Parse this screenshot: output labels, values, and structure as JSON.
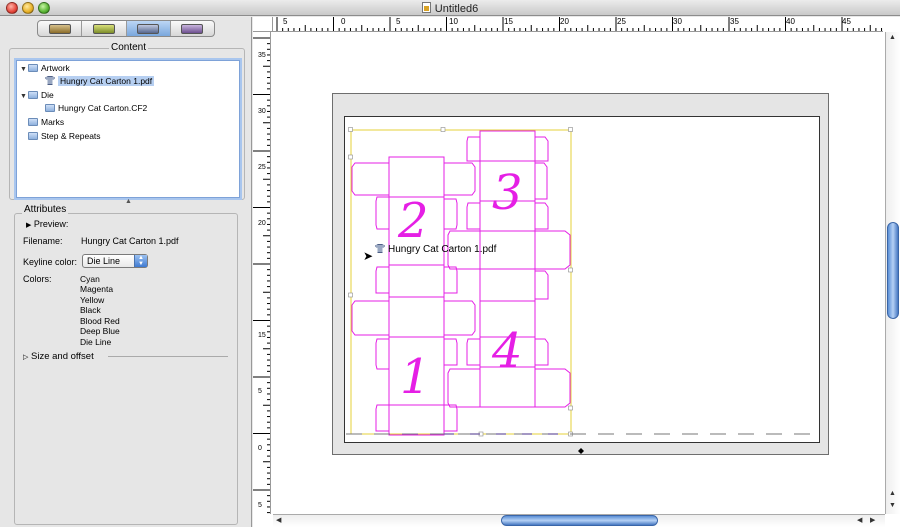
{
  "window": {
    "title": "Untitled6"
  },
  "toolbar": {
    "tabs": [
      "job",
      "marks",
      "artwork",
      "sheet"
    ]
  },
  "content": {
    "title": "Content",
    "tree": [
      {
        "label": "Artwork",
        "level": 0,
        "expanded": true,
        "kind": "folder"
      },
      {
        "label": "Hungry Cat Carton 1.pdf",
        "level": 1,
        "kind": "file",
        "selected": true
      },
      {
        "label": "Die",
        "level": 0,
        "expanded": true,
        "kind": "folder"
      },
      {
        "label": "Hungry Cat Carton.CF2",
        "level": 1,
        "kind": "file"
      },
      {
        "label": "Marks",
        "level": 0,
        "kind": "folder"
      },
      {
        "label": "Step & Repeats",
        "level": 0,
        "kind": "folder"
      }
    ]
  },
  "attributes": {
    "title": "Attributes",
    "preview_label": "Preview:",
    "filename_label": "Filename:",
    "filename_value": "Hungry Cat Carton 1.pdf",
    "keyline_label": "Keyline color:",
    "keyline_value": "Die Line",
    "colors_label": "Colors:",
    "colors": [
      "Cyan",
      "Magenta",
      "Yellow",
      "Black",
      "Blood Red",
      "Deep Blue",
      "Die Line"
    ],
    "size_offset_label": "Size and offset"
  },
  "rulers": {
    "horizontal": [
      "5",
      "0",
      "5",
      "10",
      "15",
      "20",
      "25",
      "30",
      "35",
      "40",
      "45"
    ],
    "vertical": [
      "35",
      "30",
      "25",
      "20",
      "15",
      "10",
      "5",
      "0",
      "5"
    ]
  },
  "canvas": {
    "placed_label": "Hungry Cat Carton 1.pdf",
    "carton_numbers": [
      "2",
      "3",
      "1",
      "4"
    ],
    "dieline_color": "#e51fe5",
    "bounds_color": "#e5d13a"
  }
}
